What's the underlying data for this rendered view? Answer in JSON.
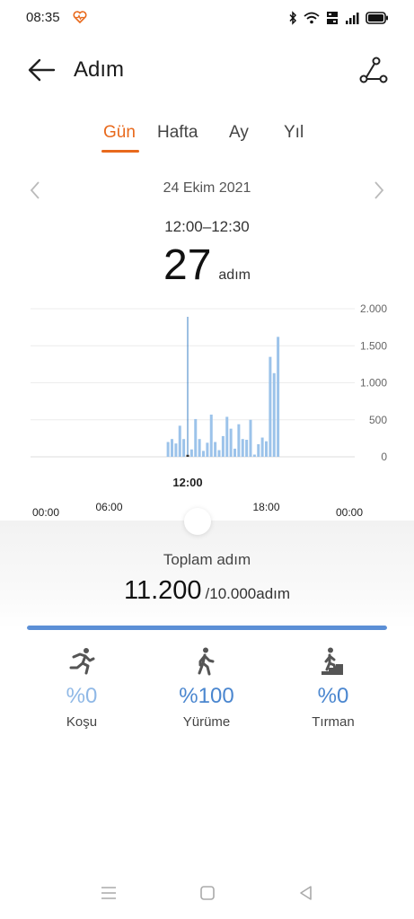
{
  "status_bar": {
    "time": "08:35",
    "icons": [
      "heart-pulse-icon",
      "bluetooth-icon",
      "wifi-icon",
      "volte-icon",
      "signal-icon",
      "battery-icon"
    ]
  },
  "header": {
    "title": "Adım",
    "back_icon": "arrow-left-icon",
    "share_icon": "route-share-icon"
  },
  "tabs": [
    {
      "label": "Gün",
      "active": true
    },
    {
      "label": "Hafta",
      "active": false
    },
    {
      "label": "Ay",
      "active": false
    },
    {
      "label": "Yıl",
      "active": false
    }
  ],
  "date_nav": {
    "date": "24 Ekim 2021"
  },
  "selection": {
    "range": "12:00–12:30",
    "value": "27",
    "unit": "adım"
  },
  "chart_data": {
    "type": "bar",
    "ylim": [
      0,
      2000
    ],
    "y_ticks": [
      "2.000",
      "1.500",
      "1.000",
      "500",
      "0"
    ],
    "x_ticks": [
      {
        "t": 0,
        "label": "00:00"
      },
      {
        "t": 6,
        "label": "06:00"
      },
      {
        "t": 18,
        "label": "18:00"
      },
      {
        "t": 24,
        "label": "00:00"
      }
    ],
    "selected_label": "12:00",
    "selected_t": 12.0,
    "bar_color": "#9cc3ea",
    "selected_color": "#3a7fc4",
    "bars": [
      {
        "t": 10.5,
        "v": 200
      },
      {
        "t": 10.8,
        "v": 240
      },
      {
        "t": 11.1,
        "v": 180
      },
      {
        "t": 11.4,
        "v": 420
      },
      {
        "t": 11.7,
        "v": 240
      },
      {
        "t": 12.0,
        "v": 27
      },
      {
        "t": 12.3,
        "v": 100
      },
      {
        "t": 12.6,
        "v": 510
      },
      {
        "t": 12.9,
        "v": 240
      },
      {
        "t": 13.2,
        "v": 80
      },
      {
        "t": 13.5,
        "v": 190
      },
      {
        "t": 13.8,
        "v": 570
      },
      {
        "t": 14.1,
        "v": 200
      },
      {
        "t": 14.4,
        "v": 90
      },
      {
        "t": 14.7,
        "v": 280
      },
      {
        "t": 15.0,
        "v": 540
      },
      {
        "t": 15.3,
        "v": 380
      },
      {
        "t": 15.6,
        "v": 110
      },
      {
        "t": 15.9,
        "v": 440
      },
      {
        "t": 16.2,
        "v": 240
      },
      {
        "t": 16.5,
        "v": 230
      },
      {
        "t": 16.8,
        "v": 500
      },
      {
        "t": 17.1,
        "v": 30
      },
      {
        "t": 17.4,
        "v": 170
      },
      {
        "t": 17.7,
        "v": 260
      },
      {
        "t": 18.0,
        "v": 210
      },
      {
        "t": 18.3,
        "v": 1350
      },
      {
        "t": 18.6,
        "v": 1130
      },
      {
        "t": 18.9,
        "v": 1620
      }
    ]
  },
  "summary": {
    "label": "Toplam adım",
    "total": "11.200",
    "goal": "/10.000adım",
    "progress": 1.0,
    "progress_color": "#5b8fd6"
  },
  "activities": [
    {
      "icon": "running-icon",
      "percent": "%0",
      "label": "Koşu",
      "color": "#8fb8e6"
    },
    {
      "icon": "walking-icon",
      "percent": "%100",
      "label": "Yürüme",
      "color": "#4a86cf"
    },
    {
      "icon": "climbing-icon",
      "percent": "%0",
      "label": "Tırman",
      "color": "#4a86cf"
    }
  ],
  "nav": {
    "icons": [
      "menu-icon",
      "home-square-icon",
      "back-triangle-icon"
    ]
  }
}
